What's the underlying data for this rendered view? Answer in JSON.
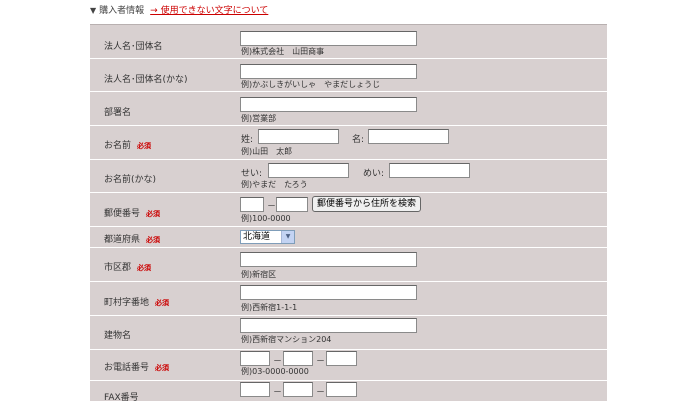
{
  "header": {
    "title": "購入者情報",
    "link": "→ 使用できない文字について"
  },
  "required_mark": "必須",
  "fields": {
    "company": {
      "label": "法人名･団体名",
      "hint": "例)株式会社　山田商事"
    },
    "company_kana": {
      "label": "法人名･団体名(かな)",
      "hint": "例)かぶしきがいしゃ　やまだしょうじ"
    },
    "department": {
      "label": "部署名",
      "hint": "例)営業部"
    },
    "name": {
      "label": "お名前",
      "sei_label": "姓:",
      "mei_label": "名:",
      "hint": "例)山田　太郎"
    },
    "name_kana": {
      "label": "お名前(かな)",
      "sei_label": "せい:",
      "mei_label": "めい:",
      "hint": "例)やまだ　たろう"
    },
    "postal": {
      "label": "郵便番号",
      "dash": "－",
      "hint": "例)100-0000",
      "button": "郵便番号から住所を検索"
    },
    "prefecture": {
      "label": "都道府県",
      "selected": "北海道"
    },
    "city": {
      "label": "市区郡",
      "hint": "例)新宿区"
    },
    "town": {
      "label": "町村字番地",
      "hint": "例)西新宿1-1-1"
    },
    "building": {
      "label": "建物名",
      "hint": "例)西新宿マンション204"
    },
    "phone": {
      "label": "お電話番号",
      "dash": "－",
      "hint": "例)03-0000-0000"
    },
    "fax": {
      "label": "FAX番号",
      "dash": "－"
    }
  }
}
